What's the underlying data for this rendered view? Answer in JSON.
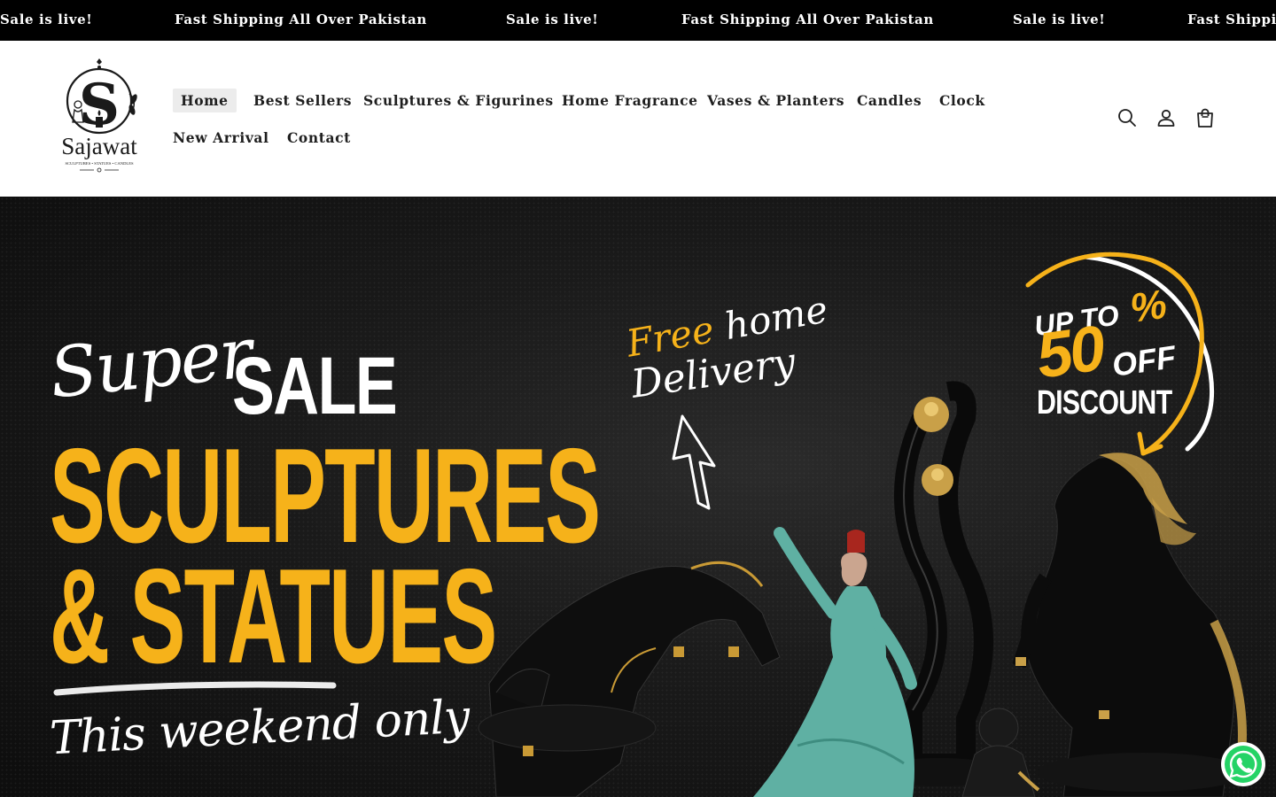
{
  "announcement": {
    "items": [
      "Sale is live!",
      "Fast Shipping All Over Pakistan",
      "Sale is live!",
      "Fast Shipping All Over Pakistan",
      "Sale is live!",
      "Fast Shipping All Over Pakistan"
    ]
  },
  "header": {
    "logo": {
      "name": "Sajawat",
      "tagline": "SCULPTURES • STATUES • CANDLES"
    },
    "nav": [
      {
        "label": "Home",
        "active": true
      },
      {
        "label": "Best Sellers"
      },
      {
        "label": "Sculptures & Figurines"
      },
      {
        "label": "Home Fragrance"
      },
      {
        "label": "Vases & Planters"
      },
      {
        "label": "Candles"
      },
      {
        "label": "Clock"
      },
      {
        "label": "New Arrival"
      },
      {
        "label": "Contact"
      }
    ],
    "icons": [
      "search-icon",
      "account-icon",
      "cart-icon"
    ]
  },
  "hero": {
    "super": "Super",
    "sale": "SALE",
    "line1": "SCULPTURES",
    "line2": "& STATUES",
    "weekend": "This weekend only",
    "free": "Free",
    "home": "home",
    "delivery": "Delivery",
    "upto": "UP TO",
    "percent": "%",
    "fifty": "50",
    "off": "OFF",
    "discount": "DISCOUNT"
  },
  "colors": {
    "announcement_bg": "#000000",
    "accent_yellow": "#f6b21a",
    "nav_active_bg": "#ececec",
    "whatsapp_green": "#25d366"
  },
  "floating": {
    "icon": "whatsapp-icon"
  }
}
